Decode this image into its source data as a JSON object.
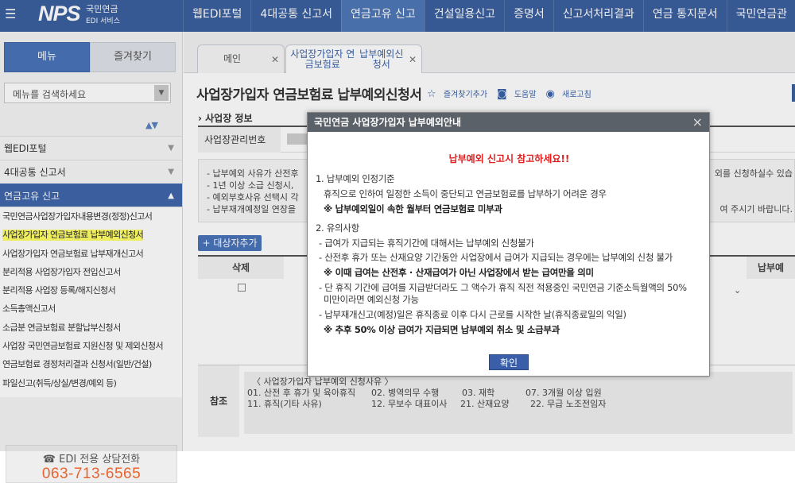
{
  "header": {
    "logo_text": "NPS",
    "logo_kr": "국민연금",
    "logo_sub": "EDI 서비스",
    "nav": [
      "웹EDI포털",
      "4대공통 신고서",
      "연금고유 신고",
      "건설일용신고",
      "증명서",
      "신고서처리결과",
      "연금 통지문서",
      "국민연금관"
    ],
    "active_nav": 2
  },
  "sidebar": {
    "tab_menu": "메뉴",
    "tab_favorites": "즐겨찾기",
    "search_placeholder": "메뉴를 검색하세요",
    "menu": [
      {
        "label": "웹EDI포털",
        "open": false
      },
      {
        "label": "4대공통 신고서",
        "open": false
      },
      {
        "label": "연금고유 신고",
        "open": true
      }
    ],
    "sub_items": [
      "국민연금사업장가입자내용변경(정정)신고서",
      "사업장가입자 연금보험료 납부예외신청서",
      "사업장가입자 연금보험료 납부재개신고서",
      "분리적용 사업장가입자 전입신고서",
      "분리적용 사업장 등록/해지신청서",
      "소득총액신고서",
      "소급분 연금보험료 분할납부신청서",
      "사업장 국민연금보험료 지원신청 및 제외신청서",
      "연금보험료 경정처리결과 신청서(일반/건설)",
      "파일신고(취득/상실/변경/예외 등)"
    ],
    "highlighted_index": 1,
    "contact_title": "☎ EDI 전용 상담전화",
    "contact_number": "063-713-6565"
  },
  "tabs": [
    {
      "label": "메인",
      "active": false
    },
    {
      "label_line1": "사업장가입자 연금보험료",
      "label_line2": "납부예외신청서",
      "active": true
    }
  ],
  "page": {
    "title": "사업장가입자 연금보험료 납부예외신청서",
    "tool_fav": "즐겨찾기추가",
    "tool_help": "도움말",
    "tool_refresh": "새로고침",
    "section_title": "› 사업장 정보",
    "field_label": "사업장관리번호",
    "notes": [
      "- 납부예외 사유가 산전후",
      "- 1년 이상 소급 신청시, ",
      "- 예외부호사유 선택시 각",
      "- 납부재개예정일 연장을"
    ],
    "note_right_1": "외를 신청하실수 있습",
    "note_right_4": "여 주시기 바랍니다.",
    "add_button": "+ 대상자추가",
    "grid_headers": [
      "삭제",
      "납부예"
    ],
    "ref_label": "참조",
    "ref_title": "〈 사업장가입자 납부예외 신청사유 〉",
    "ref_row1": [
      "01. 산전 후 휴가 및 육아휴직",
      "02. 병역의무 수행",
      "03. 재학",
      "07. 3개월 이상 입원"
    ],
    "ref_row2": [
      "11. 휴직(기타 사유)",
      "12. 무보수 대표이사",
      "21. 산재요양",
      "22. 무급 노조전임자"
    ]
  },
  "modal": {
    "title": "국민연금 사업장가입자 납부예외안내",
    "headline": "납부예외 신고시 참고하세요!!",
    "s1_title": "1. 납부예외 인정기준",
    "s1_line1": "휴직으로 인하여 일정한 소득이 중단되고 연금보험료를 납부하기 어려운 경우",
    "s1_line2": "※ 납부예외일이 속한 월부터 연금보험료 미부과",
    "s2_title": "2. 유의사항",
    "s2_line1": "- 급여가 지급되는 휴직기간에 대해서는 납부예외 신청불가",
    "s2_line2": "- 산전후 휴가 또는 산재요양 기간동안 사업장에서 급여가 지급되는 경우에는 납부예외 신청 불가",
    "s2_line3": "※ 이때 급여는 산전후 · 산재급여가 아닌 사업장에서 받는 급여만을 의미",
    "s2_line4": "- 단 휴직 기간에 급여를 지급받더라도 그 액수가 휴직 직전 적용중인 국민연금 기준소득월액의 50%",
    "s2_line5": "미만이라면 예외신청 가능",
    "s2_line6": "- 납부재개신고(예정)일은 휴직종료 이후 다시 근로를 시작한 날(휴직종료일의 익일)",
    "s2_line7": "※ 추후 50% 이상 급여가 지급되면 납부예외 취소 및 소급부과",
    "ok_button": "확인"
  }
}
